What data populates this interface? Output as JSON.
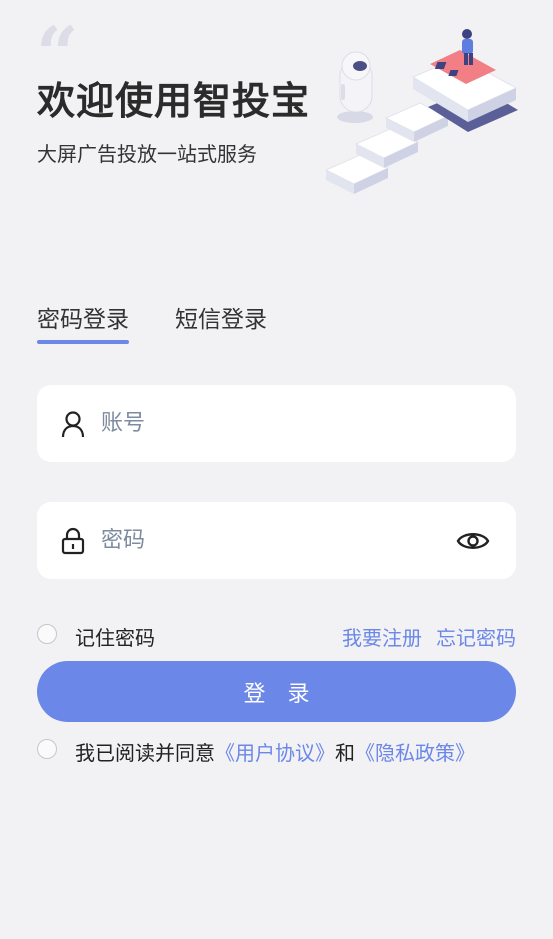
{
  "header": {
    "title": "欢迎使用智投宝",
    "subtitle": "大屏广告投放一站式服务"
  },
  "tabs": [
    {
      "label": "密码登录",
      "active": true
    },
    {
      "label": "短信登录",
      "active": false
    }
  ],
  "form": {
    "account_placeholder": "账号",
    "password_placeholder": "密码"
  },
  "options": {
    "remember_label": "记住密码",
    "register_link": "我要注册",
    "forgot_link": "忘记密码"
  },
  "login_button": "登录",
  "agreement": {
    "prefix": "我已阅读并同意",
    "user_agreement": "《用户协议》",
    "and": "和",
    "privacy_policy": "《隐私政策》"
  },
  "colors": {
    "accent": "#6b87e8",
    "background": "#f2f2f4",
    "field": "#ffffff"
  },
  "icons": [
    "quote-icon",
    "user-icon",
    "lock-icon",
    "eye-icon"
  ]
}
